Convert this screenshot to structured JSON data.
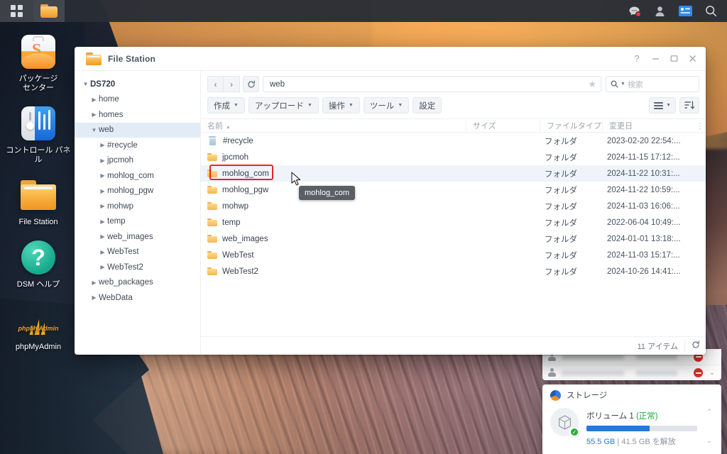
{
  "taskbar": {
    "left_items": [
      {
        "name": "app-menu",
        "icon": "grid-icon"
      },
      {
        "name": "file-station-taskbar",
        "icon": "folder-icon"
      }
    ],
    "right_items": [
      {
        "name": "notifications",
        "icon": "chat-bubble-icon",
        "badge": true
      },
      {
        "name": "user-menu",
        "icon": "person-icon",
        "badge": false
      },
      {
        "name": "widgets",
        "icon": "widget-panel-icon",
        "badge": false
      },
      {
        "name": "search",
        "icon": "search-icon",
        "badge": false
      }
    ]
  },
  "desktop_icons": [
    {
      "label": "パッケージ\nセンター",
      "label_line1": "パッケージ",
      "label_line2": "センター",
      "icon": "package-center-icon"
    },
    {
      "label": "コントロール パネル",
      "icon": "control-panel-icon"
    },
    {
      "label": "File Station",
      "icon": "file-station-icon"
    },
    {
      "label": "DSM ヘルプ",
      "icon": "dsm-help-icon"
    },
    {
      "label": "phpMyAdmin",
      "icon": "phpmyadmin-icon"
    }
  ],
  "window": {
    "title": "File Station",
    "controls": {
      "help": "?",
      "minimize": "—",
      "maximize": "▢",
      "close": "✕"
    }
  },
  "sidebar": {
    "items": [
      {
        "label": "DS720",
        "level": 0,
        "arrow": "down",
        "selected": false,
        "root": true
      },
      {
        "label": "home",
        "level": 1,
        "arrow": "right",
        "selected": false
      },
      {
        "label": "homes",
        "level": 1,
        "arrow": "right",
        "selected": false
      },
      {
        "label": "web",
        "level": 1,
        "arrow": "down",
        "selected": true
      },
      {
        "label": "#recycle",
        "level": 2,
        "arrow": "right",
        "selected": false
      },
      {
        "label": "jpcmoh",
        "level": 2,
        "arrow": "right",
        "selected": false
      },
      {
        "label": "mohlog_com",
        "level": 2,
        "arrow": "right",
        "selected": false
      },
      {
        "label": "mohlog_pgw",
        "level": 2,
        "arrow": "right",
        "selected": false
      },
      {
        "label": "mohwp",
        "level": 2,
        "arrow": "right",
        "selected": false
      },
      {
        "label": "temp",
        "level": 2,
        "arrow": "right",
        "selected": false
      },
      {
        "label": "web_images",
        "level": 2,
        "arrow": "right",
        "selected": false
      },
      {
        "label": "WebTest",
        "level": 2,
        "arrow": "right",
        "selected": false
      },
      {
        "label": "WebTest2",
        "level": 2,
        "arrow": "right",
        "selected": false
      },
      {
        "label": "web_packages",
        "level": 1,
        "arrow": "right",
        "selected": false
      },
      {
        "label": "WebData",
        "level": 1,
        "arrow": "right",
        "selected": false
      }
    ]
  },
  "toolbar": {
    "back": "‹",
    "forward": "›",
    "refresh": "⟳",
    "path_value": "web",
    "favorite_icon": "star-icon",
    "search_placeholder": "検索",
    "search_icon": "search-icon",
    "buttons": [
      {
        "label": "作成",
        "caret": true
      },
      {
        "label": "アップロード",
        "caret": true
      },
      {
        "label": "操作",
        "caret": true
      },
      {
        "label": "ツール",
        "caret": true
      },
      {
        "label": "設定",
        "caret": false
      }
    ],
    "view_list_icon": "list-view-icon",
    "sort_icon": "sort-descending-icon"
  },
  "table": {
    "columns": [
      {
        "key": "name",
        "label": "名前",
        "sort": "asc"
      },
      {
        "key": "size",
        "label": "サイズ"
      },
      {
        "key": "type",
        "label": "ファイルタイプ"
      },
      {
        "key": "date",
        "label": "変更日"
      }
    ],
    "rows": [
      {
        "name": "#recycle",
        "icon": "trash-icon",
        "size": "",
        "type": "フォルダ",
        "date": "2023-02-20 22:54:...",
        "selected": false
      },
      {
        "name": "jpcmoh",
        "icon": "folder-icon",
        "size": "",
        "type": "フォルダ",
        "date": "2024-11-15 17:12:...",
        "selected": false
      },
      {
        "name": "mohlog_com",
        "icon": "folder-icon",
        "size": "",
        "type": "フォルダ",
        "date": "2024-11-22 10:31:...",
        "selected": true
      },
      {
        "name": "mohlog_pgw",
        "icon": "folder-icon",
        "size": "",
        "type": "フォルダ",
        "date": "2024-11-22 10:59:...",
        "selected": false
      },
      {
        "name": "mohwp",
        "icon": "folder-icon",
        "size": "",
        "type": "フォルダ",
        "date": "2024-11-03 16:06:...",
        "selected": false
      },
      {
        "name": "temp",
        "icon": "folder-icon",
        "size": "",
        "type": "フォルダ",
        "date": "2022-06-04 10:49:...",
        "selected": false
      },
      {
        "name": "web_images",
        "icon": "folder-icon",
        "size": "",
        "type": "フォルダ",
        "date": "2024-01-01 13:18:...",
        "selected": false
      },
      {
        "name": "WebTest",
        "icon": "folder-icon",
        "size": "",
        "type": "フォルダ",
        "date": "2024-11-03 15:17:...",
        "selected": false
      },
      {
        "name": "WebTest2",
        "icon": "folder-icon",
        "size": "",
        "type": "フォルダ",
        "date": "2024-10-26 14:41:...",
        "selected": false
      }
    ]
  },
  "tooltip": {
    "text": "mohlog_com"
  },
  "highlight": {
    "color": "#e8242a",
    "target": "mohlog_com"
  },
  "status_bar": {
    "item_count": "11 アイテム",
    "refresh_icon": "refresh-icon"
  },
  "widget": {
    "user_rows": [
      {
        "avatar": "person-icon",
        "stop_icon": "stop-icon",
        "chevron": false
      },
      {
        "avatar": "person-icon",
        "stop_icon": "stop-icon",
        "chevron": true,
        "chevron_glyph": "⌄"
      }
    ],
    "storage": {
      "title": "ストレージ",
      "icon": "storage-pie-icon",
      "volume_name": "ボリューム 1",
      "volume_status": "(正常)",
      "disk_icon": "volume-cube-icon",
      "status_icon": "check-circle-icon",
      "used": "55.5 GB",
      "separator": "|",
      "free": "41.5 GB を解放",
      "bar_percent": 57,
      "up_arrow": "⌃",
      "down_arrow": "⌄",
      "accent": "#2878d8",
      "ok_color": "#28a745"
    }
  }
}
